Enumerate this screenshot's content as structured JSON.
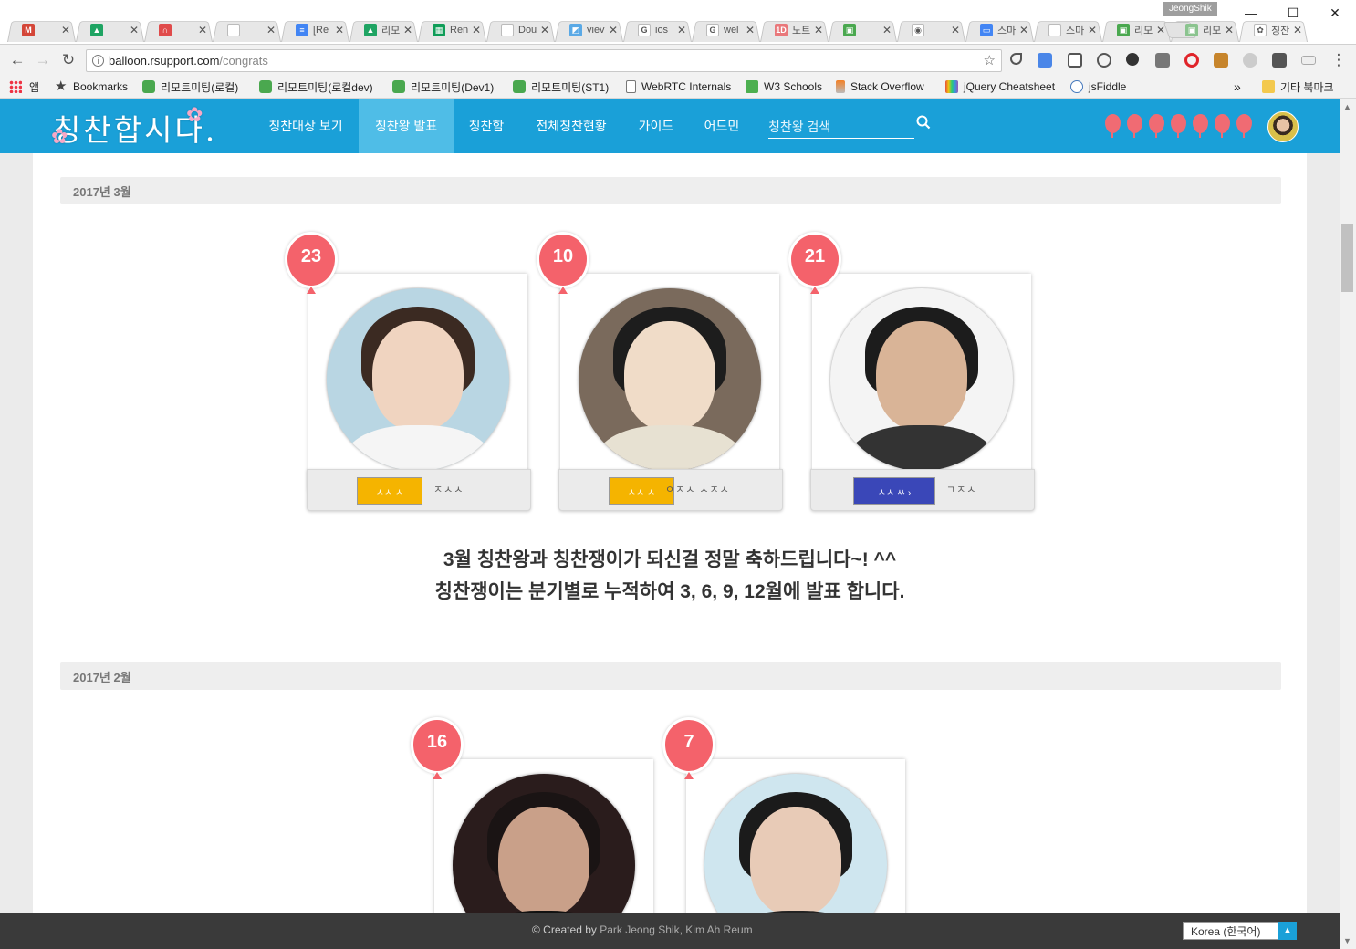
{
  "browser": {
    "profile_name": "JeongShik",
    "tabs": [
      {
        "title": "",
        "icon": "gmail-icon",
        "color": "#d44638",
        "glyph": "M"
      },
      {
        "title": "",
        "icon": "drive-icon",
        "color": "#1fa463",
        "glyph": "▲"
      },
      {
        "title": "",
        "icon": "arch-icon",
        "color": "#e04b4b",
        "glyph": "∩"
      },
      {
        "title": "",
        "icon": "page-icon",
        "color": "#ffffff",
        "glyph": ""
      },
      {
        "title": "[Re",
        "icon": "docs-icon",
        "color": "#4285f4",
        "glyph": "≡"
      },
      {
        "title": "리모",
        "icon": "drive-icon",
        "color": "#1fa463",
        "glyph": "▲"
      },
      {
        "title": "Ren",
        "icon": "sheets-icon",
        "color": "#0f9d58",
        "glyph": "▦"
      },
      {
        "title": "Dou",
        "icon": "page-icon",
        "color": "#ffffff",
        "glyph": ""
      },
      {
        "title": "viev",
        "icon": "image-icon",
        "color": "#5aa9e6",
        "glyph": "◩"
      },
      {
        "title": "ios",
        "icon": "google-icon",
        "color": "#ffffff",
        "glyph": "G"
      },
      {
        "title": "wel",
        "icon": "google-icon",
        "color": "#ffffff",
        "glyph": "G"
      },
      {
        "title": "노트",
        "icon": "note-icon",
        "color": "#e9787b",
        "glyph": "1D"
      },
      {
        "title": "",
        "icon": "remote-icon",
        "color": "#4aa84f",
        "glyph": "▣"
      },
      {
        "title": "",
        "icon": "record-icon",
        "color": "#ffffff",
        "glyph": "◉"
      },
      {
        "title": "스마",
        "icon": "screen-icon",
        "color": "#4285f4",
        "glyph": "▭"
      },
      {
        "title": "스마",
        "icon": "page-icon",
        "color": "#ffffff",
        "glyph": ""
      },
      {
        "title": "리모",
        "icon": "remote-icon",
        "color": "#4aa84f",
        "glyph": "▣"
      },
      {
        "title": "리모",
        "icon": "remote-icon",
        "color": "#8bc48f",
        "glyph": "▣"
      },
      {
        "title": "칭찬",
        "icon": "balloon-icon",
        "color": "#ffffff",
        "glyph": "✿",
        "active": true
      }
    ],
    "url_host": "balloon.rsupport.com",
    "url_path": "/congrats",
    "bookmarks_apps": "앱",
    "bookmarks": [
      {
        "label": "Bookmarks",
        "icon": "star-icon"
      },
      {
        "label": "리모트미팅(로컬)",
        "icon": "remote-icon"
      },
      {
        "label": "리모트미팅(로컬dev)",
        "icon": "remote-icon"
      },
      {
        "label": "리모트미팅(Dev1)",
        "icon": "remote-icon"
      },
      {
        "label": "리모트미팅(ST1)",
        "icon": "remote-icon"
      },
      {
        "label": "WebRTC Internals",
        "icon": "page-icon"
      },
      {
        "label": "W3 Schools",
        "icon": "w3-icon"
      },
      {
        "label": "Stack Overflow",
        "icon": "stackoverflow-icon"
      },
      {
        "label": "jQuery Cheatsheet",
        "icon": "jquery-icon"
      },
      {
        "label": "jsFiddle",
        "icon": "jsfiddle-icon"
      }
    ],
    "bookmarks_more": "»",
    "bookmarks_other": "기타 북마크"
  },
  "site": {
    "logo_text": "칭찬합시다.",
    "nav": [
      {
        "label": "칭찬대상 보기"
      },
      {
        "label": "칭찬왕 발표",
        "active": true
      },
      {
        "label": "칭찬함"
      },
      {
        "label": "전체칭찬현황"
      },
      {
        "label": "가이드"
      },
      {
        "label": "어드민"
      }
    ],
    "search_placeholder": "칭찬왕 검색",
    "balloon_count": 7,
    "balloon_color": "#f06b73",
    "accent_color": "#1aa0d8"
  },
  "sections": [
    {
      "month": "2017년 3월",
      "winners": [
        {
          "count": "23",
          "badge_text": "ㅅㅅ ㅅ",
          "badge_color": "#f5b400",
          "name_text": "ㅈㅅㅅ"
        },
        {
          "count": "10",
          "badge_text": "ㅅㅅ ㅅ",
          "badge_color": "#f5b400",
          "name_text": "ㅇㅈㅅ ㅅㅈㅅ"
        },
        {
          "count": "21",
          "badge_text": "ㅅㅅ ㅆ ›",
          "badge_color": "#3a47b8",
          "name_text": "ㄱㅈㅅ"
        }
      ],
      "message_line1": "3월 칭찬왕과 칭찬쟁이가 되신걸 정말 축하드립니다~! ^^",
      "message_line2": "칭찬쟁이는 분기별로 누적하여 3, 6, 9, 12월에 발표 합니다."
    },
    {
      "month": "2017년 2월",
      "winners": [
        {
          "count": "16"
        },
        {
          "count": "7"
        }
      ]
    }
  ],
  "footer": {
    "created_by_prefix": "© Created by",
    "author1": "Park Jeong Shik",
    "separator": ",",
    "author2": "Kim Ah Reum",
    "language": "Korea (한국어)"
  }
}
